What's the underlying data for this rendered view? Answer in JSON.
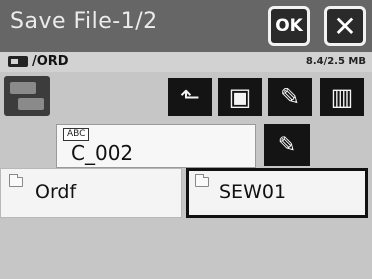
{
  "header": {
    "title": "Save File-1/2",
    "ok_label": "OK",
    "close_label": "✕"
  },
  "pathbar": {
    "path": "/ORD",
    "capacity": "8.4/2.5 MB"
  },
  "toolbar": {
    "up_glyph": "⬑",
    "newfolder_glyph": "▣",
    "rename_glyph": "✎",
    "delete_glyph": "▥"
  },
  "name_field": {
    "ime_label": "ABC",
    "value": "C_002",
    "edit_glyph": "✎"
  },
  "files": [
    {
      "name": "Ordf",
      "selected": false
    },
    {
      "name": "SEW01",
      "selected": true
    }
  ],
  "colors": {
    "title_bar": "#666666",
    "background": "#c6c6c6",
    "button_dark": "#141414"
  }
}
